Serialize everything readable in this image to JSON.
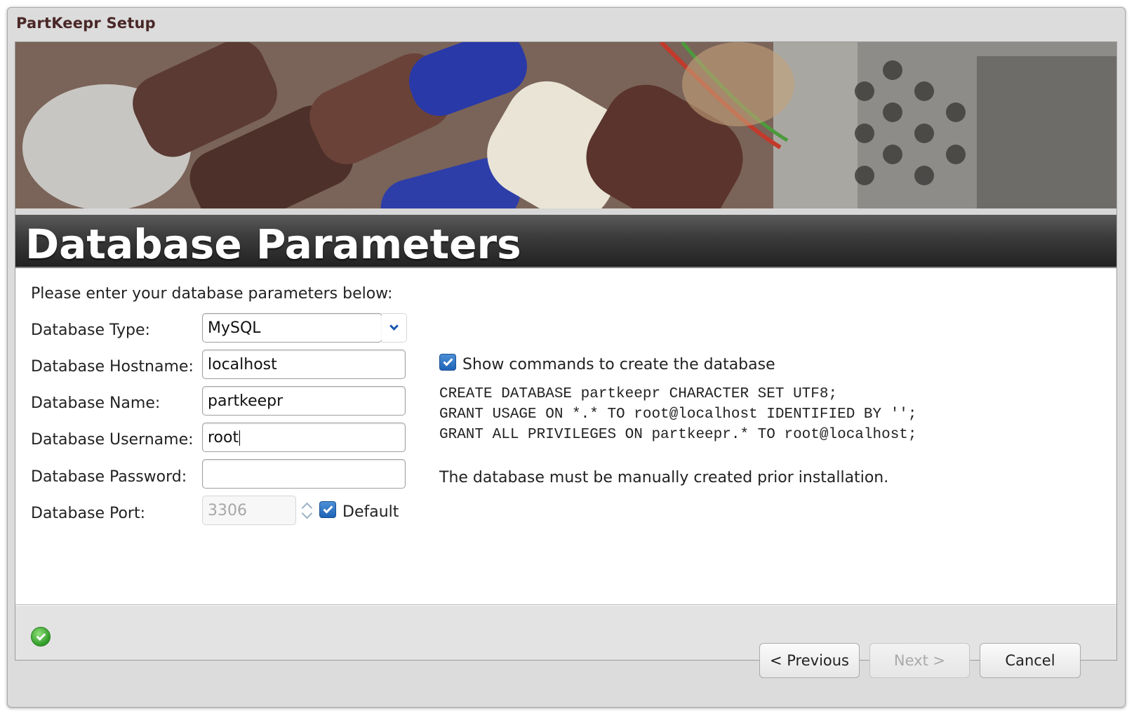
{
  "window": {
    "title": "PartKeepr Setup"
  },
  "header": {
    "title": "Database Parameters"
  },
  "form": {
    "intro": "Please enter your database parameters below:",
    "type": {
      "label": "Database Type:",
      "value": "MySQL"
    },
    "hostname": {
      "label": "Database Hostname:",
      "value": "localhost"
    },
    "name": {
      "label": "Database Name:",
      "value": "partkeepr"
    },
    "username": {
      "label": "Database Username:",
      "value": "root"
    },
    "password": {
      "label": "Database Password:",
      "value": ""
    },
    "port": {
      "label": "Database Port:",
      "value": "3306",
      "default_label": "Default",
      "default_checked": true
    }
  },
  "commands": {
    "toggle_label": "Show commands to create the database",
    "toggle_checked": true,
    "sql": [
      "CREATE DATABASE partkeepr CHARACTER SET UTF8;",
      "GRANT USAGE ON *.* TO root@localhost IDENTIFIED BY '';",
      "GRANT ALL PRIVILEGES ON partkeepr.* TO root@localhost;"
    ],
    "note": "The database must be manually created prior installation."
  },
  "buttons": {
    "previous": "< Previous",
    "next": "Next >",
    "cancel": "Cancel"
  },
  "icons": {
    "status": "check-circle-icon",
    "dropdown": "chevron-down-icon",
    "spinner": "spinner-arrows-icon"
  },
  "colors": {
    "accent": "#1f63b8",
    "success": "#2f9b27",
    "header": "#2f2f2f"
  }
}
